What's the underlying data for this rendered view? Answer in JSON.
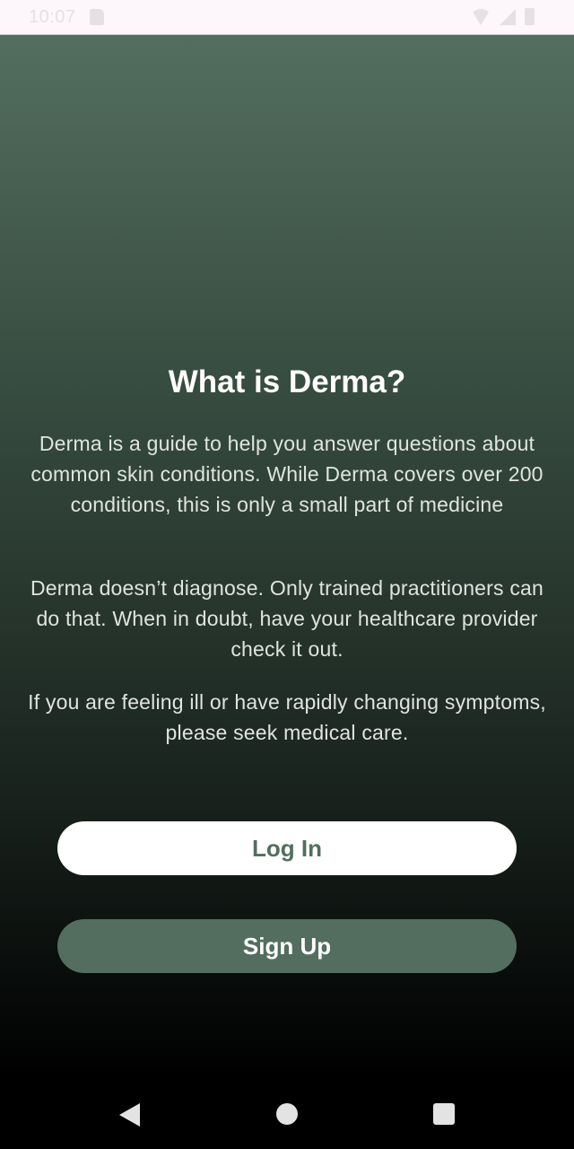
{
  "status_bar": {
    "time": "10:07"
  },
  "main": {
    "title": "What is Derma?",
    "paragraphs": [
      "Derma is a guide to help you answer questions about common skin conditions. While Derma covers over 200 conditions, this is only a small part of medicine",
      "Derma doesn’t diagnose. Only trained practitioners can do that. When in doubt, have your healthcare provider check it out.",
      "If you are feeling ill or have rapidly changing symptoms, please seek medical care."
    ],
    "login_label": "Log In",
    "signup_label": "Sign Up"
  },
  "nav_bar": {
    "icons": [
      "back-icon",
      "home-icon",
      "recents-icon"
    ]
  },
  "colors": {
    "brand_green": "#536e5f",
    "button_light": "#ffffff",
    "gradient_top": "#536e5f",
    "gradient_bottom": "#000000"
  }
}
